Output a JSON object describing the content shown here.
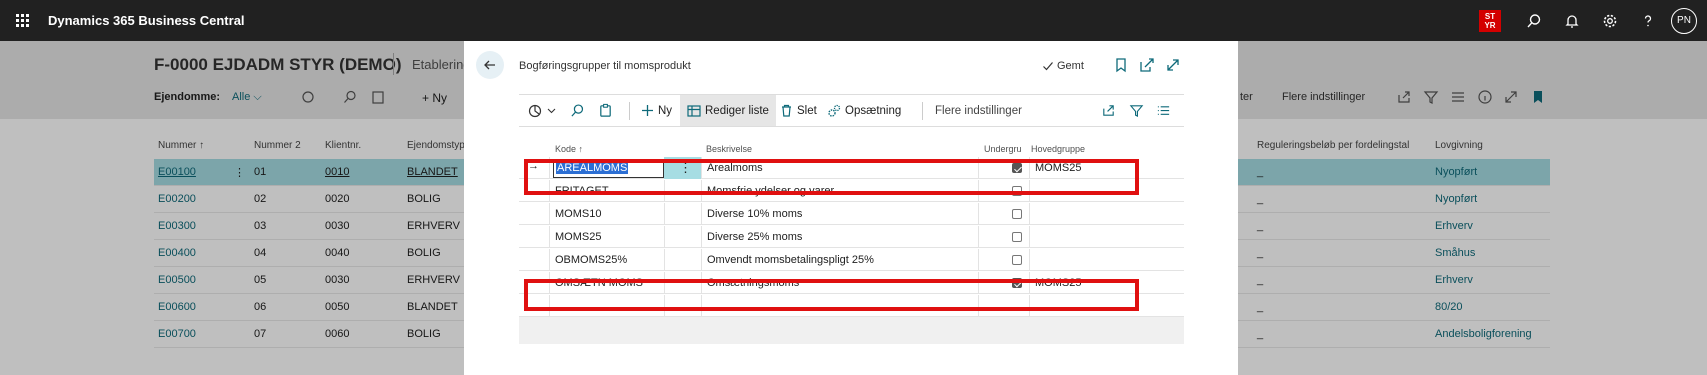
{
  "appbar": {
    "title": "Dynamics 365 Business Central",
    "badge_line1": "ST",
    "badge_line2": "YR",
    "avatar": "PN"
  },
  "background_page": {
    "title": "F-0000 EJDADM STYR (DEMO)",
    "tab": "Etablering",
    "filter_label": "Ejendomme:",
    "filter_value": "Alle",
    "new_label": "Ny",
    "more_label": "Flere indstillinger",
    "ter_label": "ter",
    "columns": [
      "Nummer",
      "Nummer 2",
      "Klientnr.",
      "Ejendomstype",
      "Reguleringsbeløb per fordelingstal",
      "Lovgivning"
    ],
    "rows": [
      {
        "nummer": "E00100",
        "nummer2": "01",
        "klient": "0010",
        "type": "BLANDET",
        "regulering": "_",
        "lov": "Nyopført"
      },
      {
        "nummer": "E00200",
        "nummer2": "02",
        "klient": "0020",
        "type": "BOLIG",
        "regulering": "_",
        "lov": "Nyopført"
      },
      {
        "nummer": "E00300",
        "nummer2": "03",
        "klient": "0030",
        "type": "ERHVERV",
        "regulering": "_",
        "lov": "Erhverv"
      },
      {
        "nummer": "E00400",
        "nummer2": "04",
        "klient": "0040",
        "type": "BOLIG",
        "regulering": "_",
        "lov": "Småhus"
      },
      {
        "nummer": "E00500",
        "nummer2": "05",
        "klient": "0030",
        "type": "ERHVERV",
        "regulering": "_",
        "lov": "Erhverv"
      },
      {
        "nummer": "E00600",
        "nummer2": "06",
        "klient": "0050",
        "type": "BLANDET",
        "regulering": "_",
        "lov": "80/20"
      },
      {
        "nummer": "E00700",
        "nummer2": "07",
        "klient": "0060",
        "type": "BOLIG",
        "regulering": "_",
        "lov": "Andelsboligforening"
      }
    ]
  },
  "dialog": {
    "title": "Bogføringsgrupper til momsprodukt",
    "saved_label": "Gemt",
    "toolbar": {
      "new": "Ny",
      "edit_list": "Rediger liste",
      "delete": "Slet",
      "setup": "Opsætning",
      "more": "Flere indstillinger"
    },
    "columns": {
      "code": "Kode",
      "description": "Beskrivelse",
      "subgroup": "Undergru",
      "main_group": "Hovedgruppe"
    },
    "rows": [
      {
        "code": "AREALMOMS",
        "description": "Arealmoms",
        "subgroup": true,
        "main_group": "MOMS25"
      },
      {
        "code": "FRITAGET",
        "description": "Momsfrie ydelser og varer",
        "subgroup": false,
        "main_group": ""
      },
      {
        "code": "MOMS10",
        "description": "Diverse 10% moms",
        "subgroup": false,
        "main_group": ""
      },
      {
        "code": "MOMS25",
        "description": "Diverse 25% moms",
        "subgroup": false,
        "main_group": ""
      },
      {
        "code": "OBMOMS25%",
        "description": "Omvendt momsbetalingspligt 25%",
        "subgroup": false,
        "main_group": ""
      },
      {
        "code": "OMSÆTN MOMS",
        "description": "Omsætningsmoms",
        "subgroup": true,
        "main_group": "MOMS25"
      }
    ]
  },
  "colors": {
    "appbar": "#212121",
    "accent": "#0e6a7a",
    "selected_row": "#a6dde3",
    "highlight": "#e01010"
  }
}
